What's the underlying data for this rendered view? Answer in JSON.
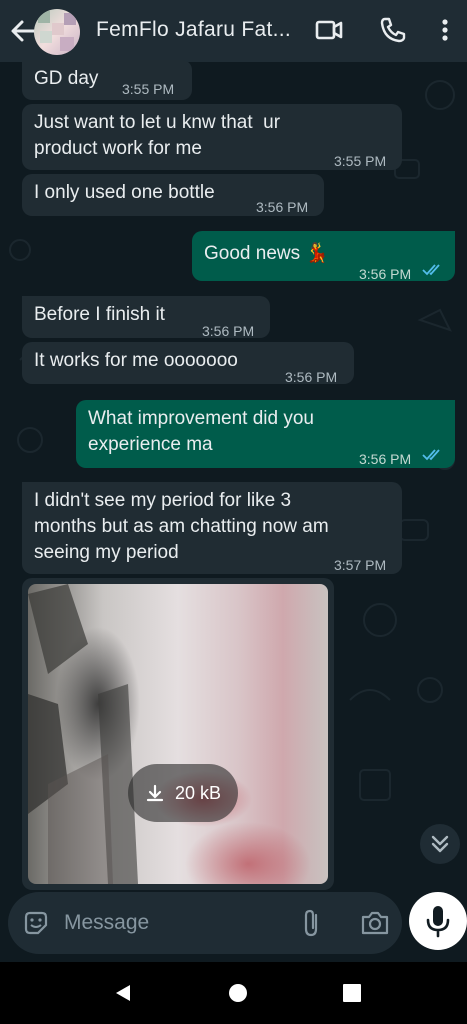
{
  "header": {
    "contact_name": "FemFlo Jafaru Fat...",
    "back_icon": "arrow-back-icon",
    "video_icon": "video-call-icon",
    "call_icon": "phone-icon",
    "menu_icon": "more-vert-icon"
  },
  "messages": [
    {
      "direction": "in",
      "text": "GD day",
      "time": "3:55 PM"
    },
    {
      "direction": "in",
      "text": "Just want to let u knw that  ur\nproduct work for me",
      "time": "3:55 PM"
    },
    {
      "direction": "in",
      "text": "I only used one bottle",
      "time": "3:56 PM"
    },
    {
      "direction": "out",
      "text": "Good news 💃",
      "time": "3:56 PM",
      "status": "read"
    },
    {
      "direction": "in",
      "text": "Before I finish it",
      "time": "3:56 PM"
    },
    {
      "direction": "in",
      "text": "It works for me ooooooo",
      "time": "3:56 PM"
    },
    {
      "direction": "out",
      "text": "What improvement did you\nexperience ma",
      "time": "3:56 PM",
      "status": "read"
    },
    {
      "direction": "in",
      "text": "I didn't see my period for like 3\nmonths but as am chatting now am\nseeing my period",
      "time": "3:57 PM"
    }
  ],
  "image_message": {
    "direction": "in",
    "download_size": "20 kB",
    "download_icon": "download-icon"
  },
  "composer": {
    "placeholder": "Message",
    "emoji_icon": "sticker-icon",
    "attach_icon": "paperclip-icon",
    "camera_icon": "camera-icon",
    "mic_icon": "mic-icon"
  },
  "colors": {
    "header_bg": "#1f2c34",
    "incoming_bubble": "#202c33",
    "outgoing_bubble": "#005c4b",
    "read_ticks": "#53bdeb",
    "wallpaper": "#0f1a20"
  }
}
